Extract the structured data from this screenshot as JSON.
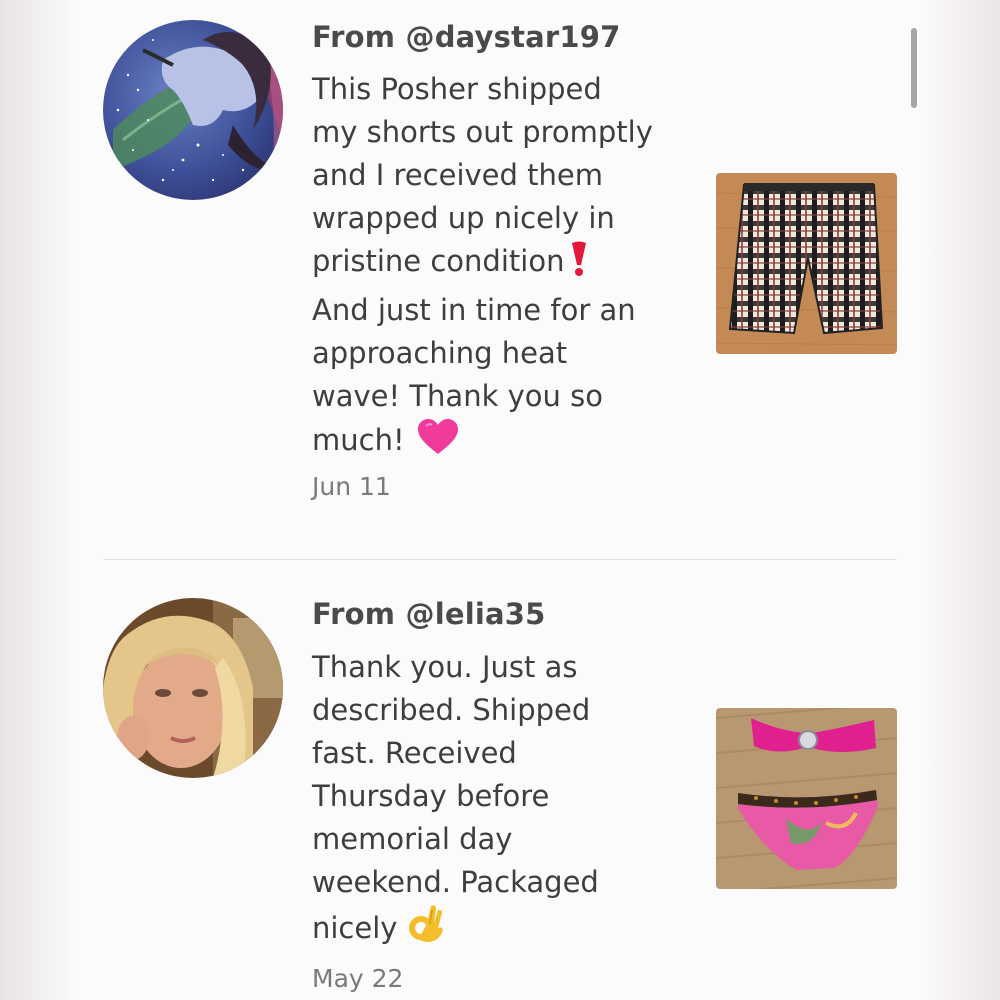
{
  "reviews": [
    {
      "from": "From @daystar197",
      "lines": [
        "This Posher shipped",
        "my shorts out promptly",
        "and I received them",
        "wrapped up nicely in",
        "pristine condition",
        "And just in time for an",
        "approaching heat",
        "wave! Thank you so",
        "much!"
      ],
      "emoji_after_line_5": "exclamation-icon",
      "emoji_after_line_9": "pink-heart-icon",
      "date": "Jun 11",
      "thumbnail": "plaid-shorts-photo",
      "avatar": "fantasy-unicorn-avatar"
    },
    {
      "from": "From @lelia35",
      "lines": [
        "Thank you. Just as",
        "described. Shipped",
        "fast. Received",
        "Thursday before",
        "memorial day",
        "weekend. Packaged",
        "nicely"
      ],
      "emoji_after_line_7": "ok-hand-icon",
      "date": "May 22",
      "thumbnail": "pink-bikini-photo",
      "avatar": "woman-selfie-avatar"
    }
  ],
  "colors": {
    "heart": "#f03b9c",
    "exclamation": "#e3173a",
    "ok_hand": "#f4be2a"
  }
}
